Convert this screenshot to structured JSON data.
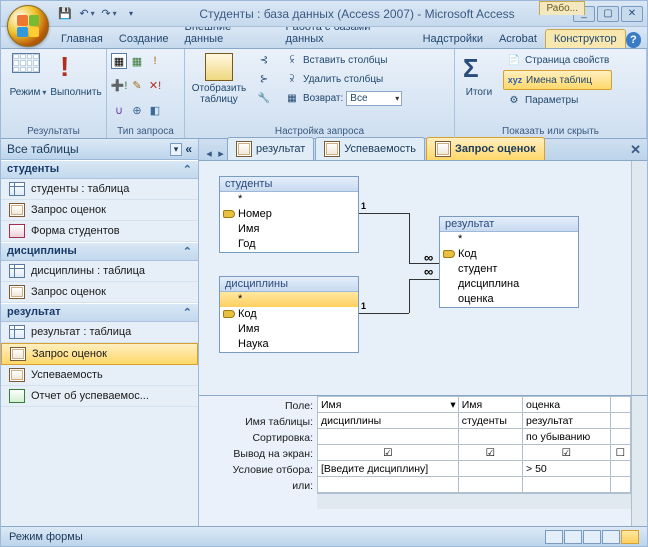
{
  "title": "Студенты : база данных (Access 2007) - Microsoft Access",
  "context_label": "Рабо...",
  "tabs": {
    "home": "Главная",
    "create": "Создание",
    "external": "Внешние данные",
    "dbwork": "Работа с базами данных",
    "addons": "Надстройки",
    "acrobat": "Acrobat",
    "design": "Конструктор"
  },
  "ribbon": {
    "results": {
      "view": "Режим",
      "run": "Выполнить",
      "group": "Результаты"
    },
    "qtype": {
      "group": "Тип запроса"
    },
    "setup": {
      "show_table": "Отобразить таблицу",
      "insert_cols": "Вставить столбцы",
      "delete_cols": "Удалить столбцы",
      "return_label": "Возврат:",
      "return_value": "Все",
      "group": "Настройка запроса"
    },
    "totals": {
      "totals": "Итоги",
      "group": "Показать или скрыть"
    },
    "show": {
      "props": "Страница свойств",
      "tnames": "Имена таблиц",
      "params": "Параметры"
    }
  },
  "nav": {
    "header": "Все таблицы",
    "g_students": "студенты",
    "i_students_tbl": "студенты : таблица",
    "i_query_grades": "Запрос оценок",
    "i_form_students": "Форма студентов",
    "g_disc": "дисциплины",
    "i_disc_tbl": "дисциплины : таблица",
    "g_result": "результат",
    "i_result_tbl": "результат : таблица",
    "i_usp": "Успеваемость",
    "i_report": "Отчет об успеваемос..."
  },
  "doctabs": {
    "t1": "результат",
    "t2": "Успеваемость",
    "t3": "Запрос оценок"
  },
  "boxes": {
    "students": {
      "title": "студенты",
      "f1": "Номер",
      "f2": "Имя",
      "f3": "Год"
    },
    "disc": {
      "title": "дисциплины",
      "f1": "Код",
      "f2": "Имя",
      "f3": "Наука"
    },
    "result": {
      "title": "результат",
      "f1": "Код",
      "f2": "студент",
      "f3": "дисциплина",
      "f4": "оценка"
    }
  },
  "grid": {
    "l_field": "Поле:",
    "l_table": "Имя таблицы:",
    "l_sort": "Сортировка:",
    "l_show": "Вывод на экран:",
    "l_crit": "Условие отбора:",
    "l_or": "или:",
    "c1_field": "Имя",
    "c1_table": "дисциплины",
    "c1_crit": "[Введите дисциплину]",
    "c2_field": "Имя",
    "c2_table": "студенты",
    "c3_field": "оценка",
    "c3_table": "результат",
    "c3_sort": "по убыванию",
    "c3_crit": "> 50"
  },
  "status": "Режим формы"
}
